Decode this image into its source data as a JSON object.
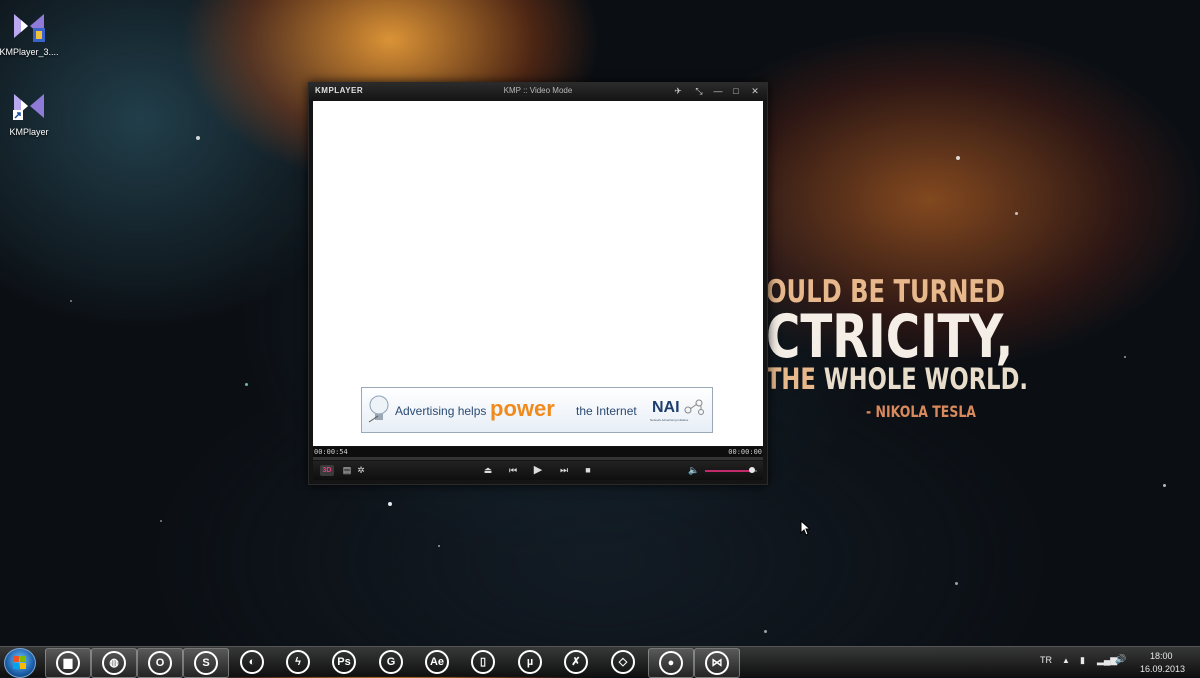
{
  "desktop": {
    "icons": [
      {
        "label": "KMPlayer_3...."
      },
      {
        "label": "KMPlayer"
      }
    ],
    "wallpaper_quote": {
      "line1": "OULD BE TURNED",
      "line2": "CTRICITY,",
      "line3_a": "THE",
      "line3_b": "WHOLE WORLD.",
      "author": "- NIKOLA TESLA"
    }
  },
  "player": {
    "logo": "KMPLAYER",
    "title": "KMP :: Video Mode",
    "ad": {
      "text_before": "Advertising helps",
      "emphasis": "power",
      "text_after": "the Internet",
      "logo": "NAI",
      "logo_sub": "Network Advertising Initiative"
    },
    "time_elapsed": "00:00:54",
    "time_total": "00:00:00",
    "volume": 0.9,
    "btn_3d": "3D"
  },
  "taskbar": {
    "apps": [
      {
        "icon": "folder-icon",
        "glyph": "▆",
        "active": true
      },
      {
        "icon": "globe-icon",
        "glyph": "◍",
        "active": true
      },
      {
        "icon": "opera-icon",
        "glyph": "O",
        "active": true
      },
      {
        "icon": "skype-icon",
        "glyph": "S",
        "active": true
      },
      {
        "icon": "earth-icon",
        "glyph": "◐",
        "active": false
      },
      {
        "icon": "flash-icon",
        "glyph": "ϟ",
        "active": false
      },
      {
        "icon": "photoshop-icon",
        "glyph": "Ps",
        "active": false
      },
      {
        "icon": "spiral-icon",
        "glyph": "G",
        "active": false
      },
      {
        "icon": "after-effects-icon",
        "glyph": "Ae",
        "active": false
      },
      {
        "icon": "phone-icon",
        "glyph": "▯",
        "active": false
      },
      {
        "icon": "utorrent-icon",
        "glyph": "µ",
        "active": false
      },
      {
        "icon": "runner-icon",
        "glyph": "✗",
        "active": false
      },
      {
        "icon": "unity-icon",
        "glyph": "◇",
        "active": false
      },
      {
        "icon": "recorder-icon",
        "glyph": "●",
        "active": true
      },
      {
        "icon": "kmplayer-icon",
        "glyph": "⋈",
        "active": true
      }
    ],
    "language": "TR",
    "clock_time": "18:00",
    "clock_date": "16.09.2013"
  }
}
